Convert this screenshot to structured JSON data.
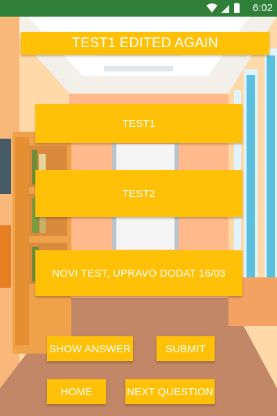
{
  "status_bar": {
    "time": "6:02",
    "icons": [
      "wifi-icon",
      "signal-icon",
      "battery-icon"
    ]
  },
  "quiz": {
    "title": "TEST1 EDITED AGAIN",
    "options": [
      "TEST1",
      "TEST2",
      "NOVI TEST, UPRAVO DODAT 16/03"
    ]
  },
  "actions": {
    "show_answer": "SHOW ANSWER",
    "submit": "SUBMIT",
    "home": "HOME",
    "next_question": "NEXT QUESTION"
  },
  "colors": {
    "button": "#ffc107",
    "status_bar": "#2f7f38",
    "button_text": "#ffffff"
  }
}
